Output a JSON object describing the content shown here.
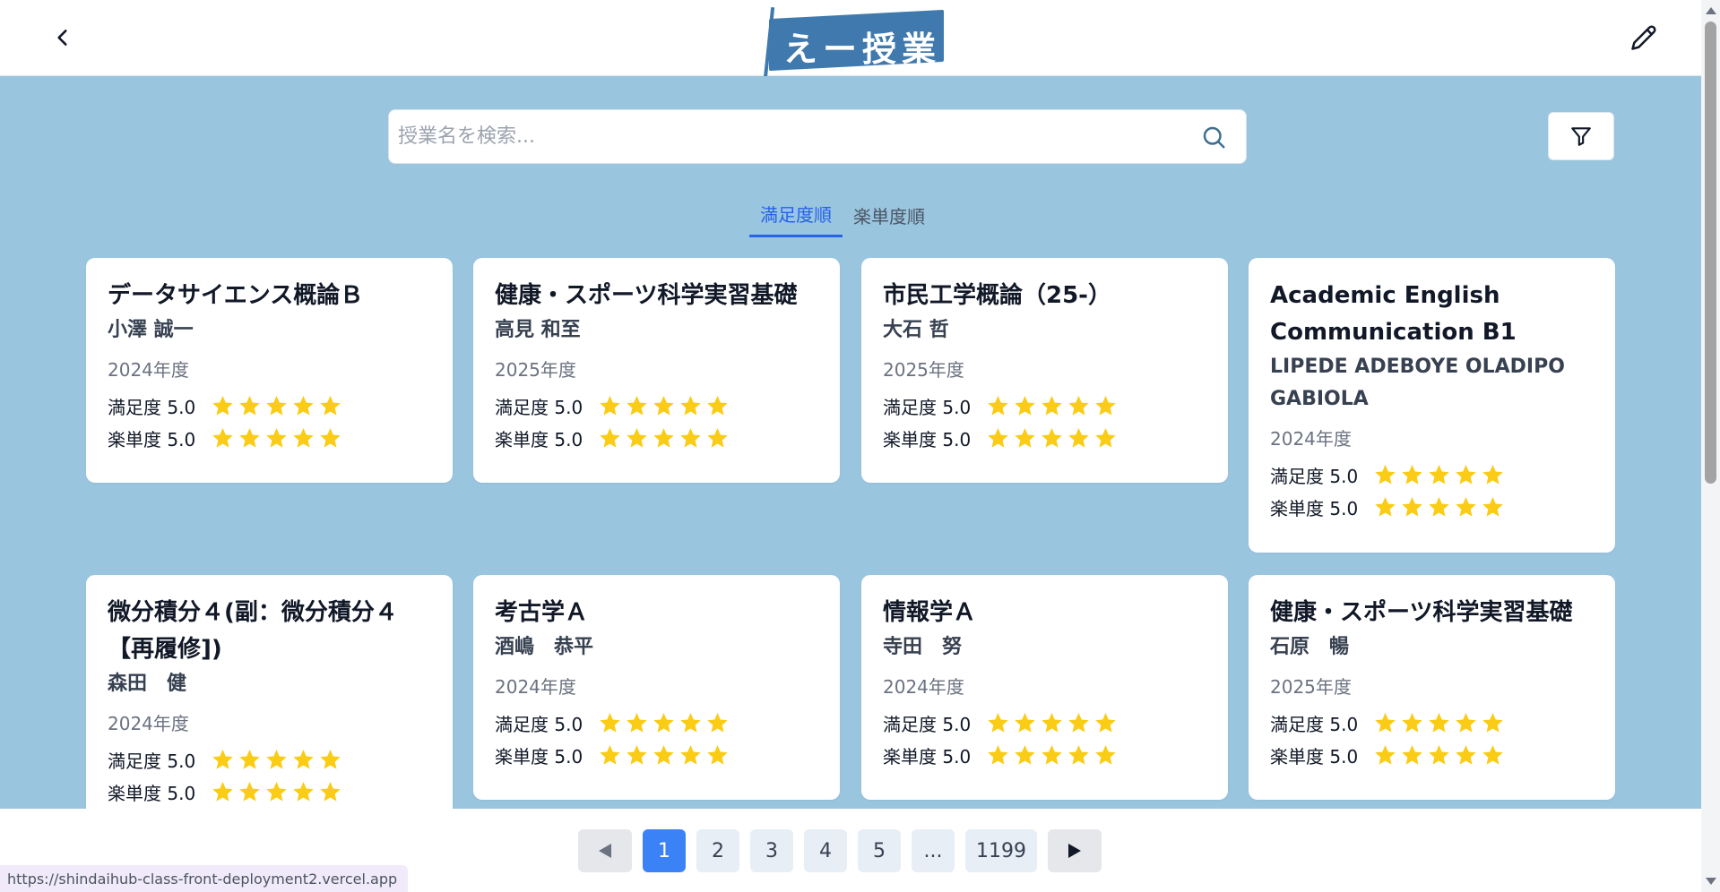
{
  "header": {
    "logo_text": "えー授業",
    "back_icon": "chevron-left-icon",
    "edit_icon": "pencil-icon"
  },
  "search": {
    "placeholder": "授業名を検索...",
    "value": "",
    "icon": "search-icon"
  },
  "filter": {
    "icon": "filter-icon"
  },
  "tabs": [
    {
      "label": "満足度順",
      "active": true
    },
    {
      "label": "楽単度順",
      "active": false
    }
  ],
  "rating_labels": {
    "satisfaction": "満足度",
    "easiness": "楽単度"
  },
  "colors": {
    "accent": "#2563eb",
    "background": "#9ac5df",
    "star": "#facc15",
    "logo": "#3f79ad",
    "page_active": "#3b82f6"
  },
  "cards": [
    {
      "title": "データサイエンス概論Ｂ",
      "teacher": "小澤 誠一",
      "year": "2024年度",
      "satisfaction": "5.0",
      "easiness": "5.0",
      "satisfaction_stars": 5,
      "easiness_stars": 5
    },
    {
      "title": "健康・スポーツ科学実習基礎",
      "teacher": "高見 和至",
      "year": "2025年度",
      "satisfaction": "5.0",
      "easiness": "5.0",
      "satisfaction_stars": 5,
      "easiness_stars": 5
    },
    {
      "title": "市民工学概論（25-）",
      "teacher": "大石 哲",
      "year": "2025年度",
      "satisfaction": "5.0",
      "easiness": "5.0",
      "satisfaction_stars": 5,
      "easiness_stars": 5
    },
    {
      "title": "Academic English Communication B1",
      "teacher": "LIPEDE ADEBOYE OLADIPO GABIOLA",
      "year": "2024年度",
      "satisfaction": "5.0",
      "easiness": "5.0",
      "satisfaction_stars": 5,
      "easiness_stars": 5
    },
    {
      "title": "微分積分４(副：微分積分４【再履修])",
      "teacher": "森田　健",
      "year": "2024年度",
      "satisfaction": "5.0",
      "easiness": "5.0",
      "satisfaction_stars": 5,
      "easiness_stars": 5
    },
    {
      "title": "考古学Ａ",
      "teacher": "酒嶋　恭平",
      "year": "2024年度",
      "satisfaction": "5.0",
      "easiness": "5.0",
      "satisfaction_stars": 5,
      "easiness_stars": 5
    },
    {
      "title": "情報学Ａ",
      "teacher": "寺田　努",
      "year": "2024年度",
      "satisfaction": "5.0",
      "easiness": "5.0",
      "satisfaction_stars": 5,
      "easiness_stars": 5
    },
    {
      "title": "健康・スポーツ科学実習基礎",
      "teacher": "石原　暢",
      "year": "2025年度",
      "satisfaction": "5.0",
      "easiness": "5.0",
      "satisfaction_stars": 5,
      "easiness_stars": 5
    }
  ],
  "pagination": {
    "prev_icon": "triangle-left-icon",
    "next_icon": "triangle-right-icon",
    "pages": [
      {
        "label": "1",
        "active": true
      },
      {
        "label": "2",
        "active": false
      },
      {
        "label": "3",
        "active": false
      },
      {
        "label": "4",
        "active": false
      },
      {
        "label": "5",
        "active": false
      },
      {
        "label": "...",
        "active": false
      },
      {
        "label": "1199",
        "active": false
      }
    ]
  },
  "status_bar": {
    "url": "https://shindaihub-class-front-deployment2.vercel.app"
  }
}
